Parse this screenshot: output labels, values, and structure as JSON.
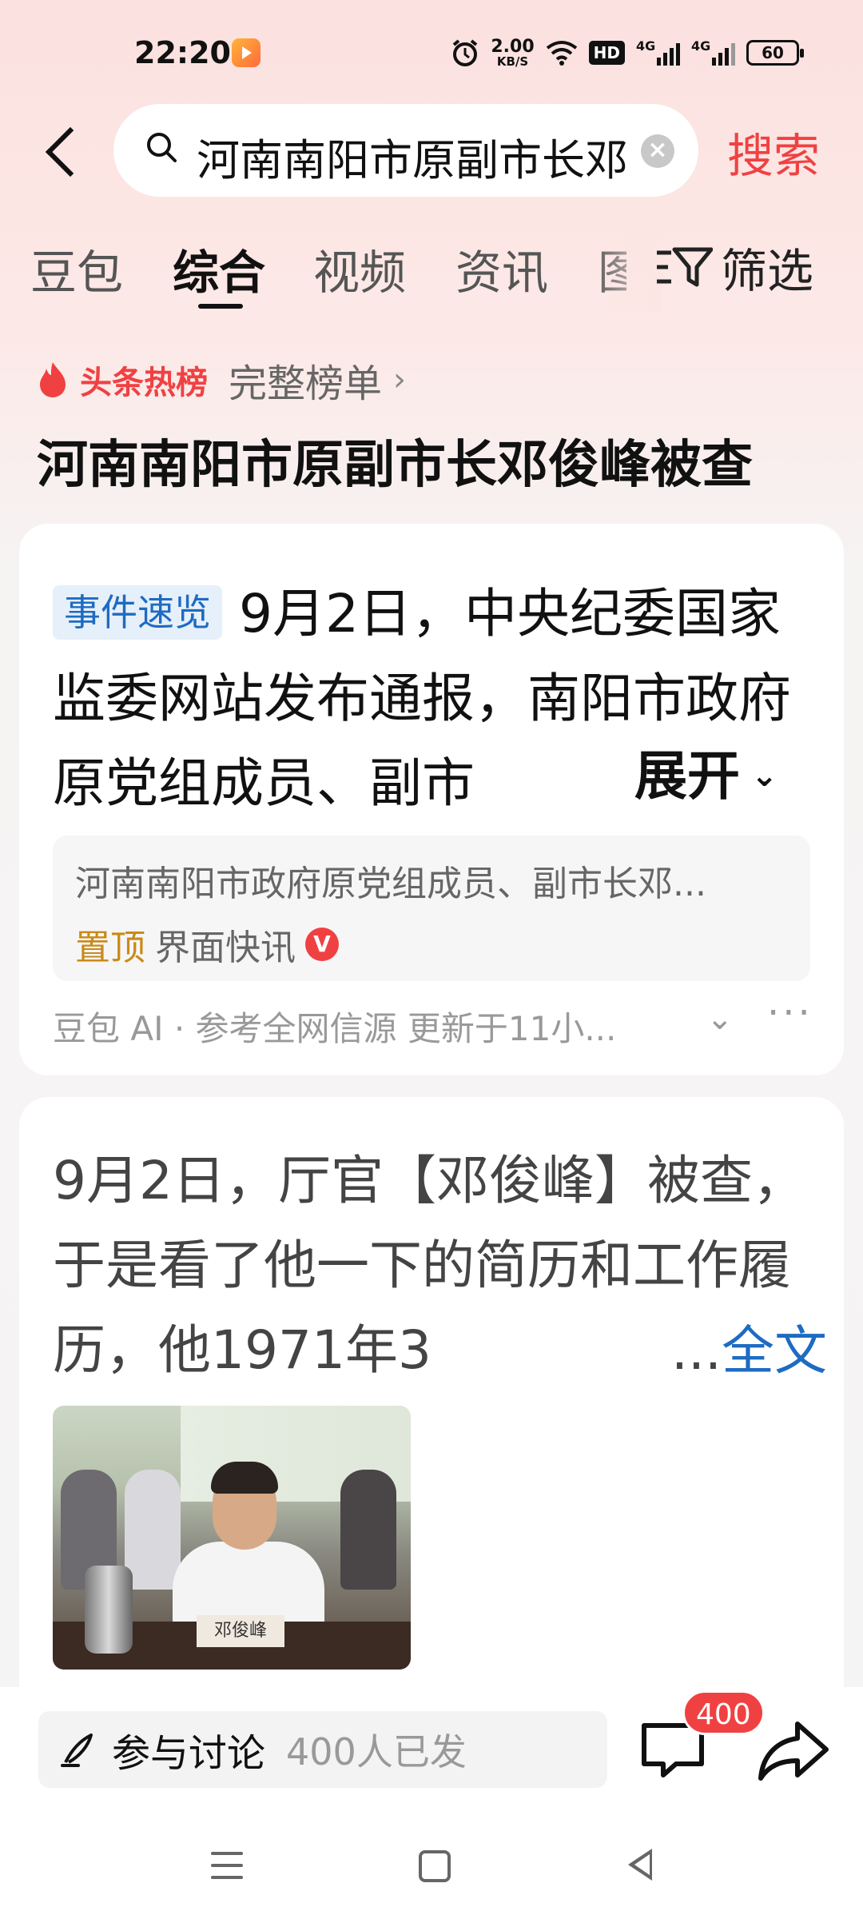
{
  "status_bar": {
    "time": "22:20",
    "net_speed_value": "2.00",
    "net_speed_unit": "KB/S",
    "hd_label": "HD",
    "sig1_label": "4G",
    "sig2_label": "4G",
    "battery": "60"
  },
  "search": {
    "query": "河南南阳市原副市长邓俊峰被查",
    "button_label": "搜索"
  },
  "tabs": {
    "items": [
      "豆包",
      "综合",
      "视频",
      "资讯",
      "图片"
    ],
    "active_index": 1,
    "filter_label": "筛选"
  },
  "hot_board": {
    "brand": "头条热榜",
    "full_list_label": "完整榜单",
    "headline": "河南南阳市原副市长邓俊峰被查"
  },
  "event_card": {
    "tag": "事件速览",
    "summary": "9月2日，中央纪委国家监委网站发布通报，南阳市政府原党组成员、副市",
    "expand_label": "展开",
    "source_title": "河南南阳市政府原党组成员、副市长邓...",
    "source_pinned": "置顶",
    "source_media": "界面快讯",
    "verified_badge": "V",
    "footer": "豆包 AI · 参考全网信源 更新于11小..."
  },
  "post_card": {
    "text": "9月2日，厅官【邓俊峰】被查，于是看了他一下的简历和工作履历，他1971年3",
    "ellipsis": "...",
    "fulltext_label": "全文",
    "photo_nameplate": "邓俊峰"
  },
  "bottom_bar": {
    "discuss_label": "参与讨论",
    "discuss_count": "400人已发",
    "comment_badge": "400"
  },
  "colors": {
    "accent_red": "#f04142",
    "link_blue": "#1e6bc2",
    "pinned_gold": "#c98a1a"
  }
}
